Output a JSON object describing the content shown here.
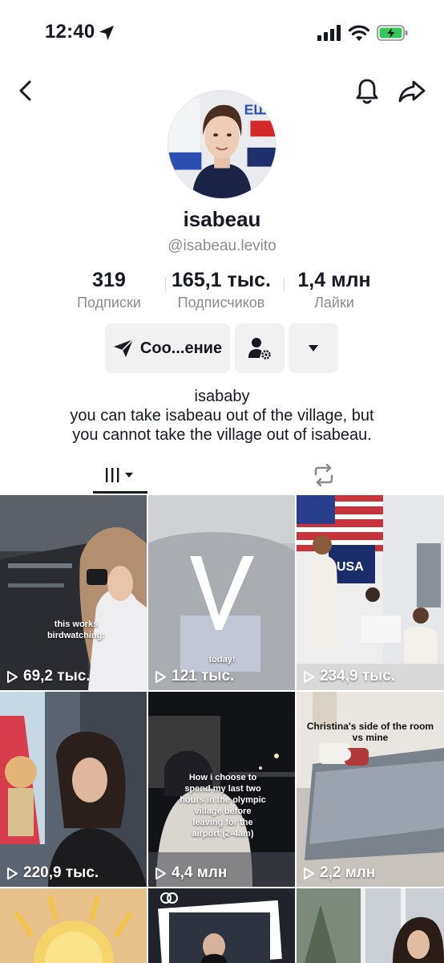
{
  "status_bar": {
    "time": "12:40"
  },
  "profile": {
    "display_name": "isabeau",
    "username": "@isabeau.levito",
    "stats": [
      {
        "value": "319",
        "label": "Подписки"
      },
      {
        "value": "165,1 тыс.",
        "label": "Подписчиков"
      },
      {
        "value": "1,4 млн",
        "label": "Лайки"
      }
    ],
    "message_button": "Соо...ение",
    "bio": {
      "line1": "isababy",
      "line2": "you can take isabeau out of the village, but",
      "line3": "you cannot take the village out of isabeau."
    }
  },
  "videos": [
    {
      "views": "69,2 тыс.",
      "caption": "this works birdwatching:"
    },
    {
      "views": "121 тыс.",
      "caption": "today!"
    },
    {
      "views": "234,9 тыс.",
      "caption": ""
    },
    {
      "views": "220,9 тыс.",
      "caption": ""
    },
    {
      "views": "4,4 млн",
      "caption": "How i choose to spend my last two hours in the olympic village before leaving for the airport (2-4am)"
    },
    {
      "views": "2,2 млн",
      "caption": "Christina's side of the room vs mine"
    },
    {
      "views": "",
      "caption": ""
    },
    {
      "views": "",
      "caption": ""
    },
    {
      "views": "",
      "caption": ""
    }
  ],
  "icons": {
    "back": "chevron-left-icon",
    "bell": "bell-icon",
    "share": "share-icon",
    "send": "send-icon",
    "add_friend": "person-gear-icon",
    "more": "caret-down-icon",
    "videos_tab": "grid-bars-icon",
    "reposts_tab": "repost-icon",
    "play": "play-icon"
  },
  "colors": {
    "text": "#161823",
    "muted": "#8a8b91",
    "button_bg": "#f1f1f2",
    "battery": "#34c759"
  }
}
